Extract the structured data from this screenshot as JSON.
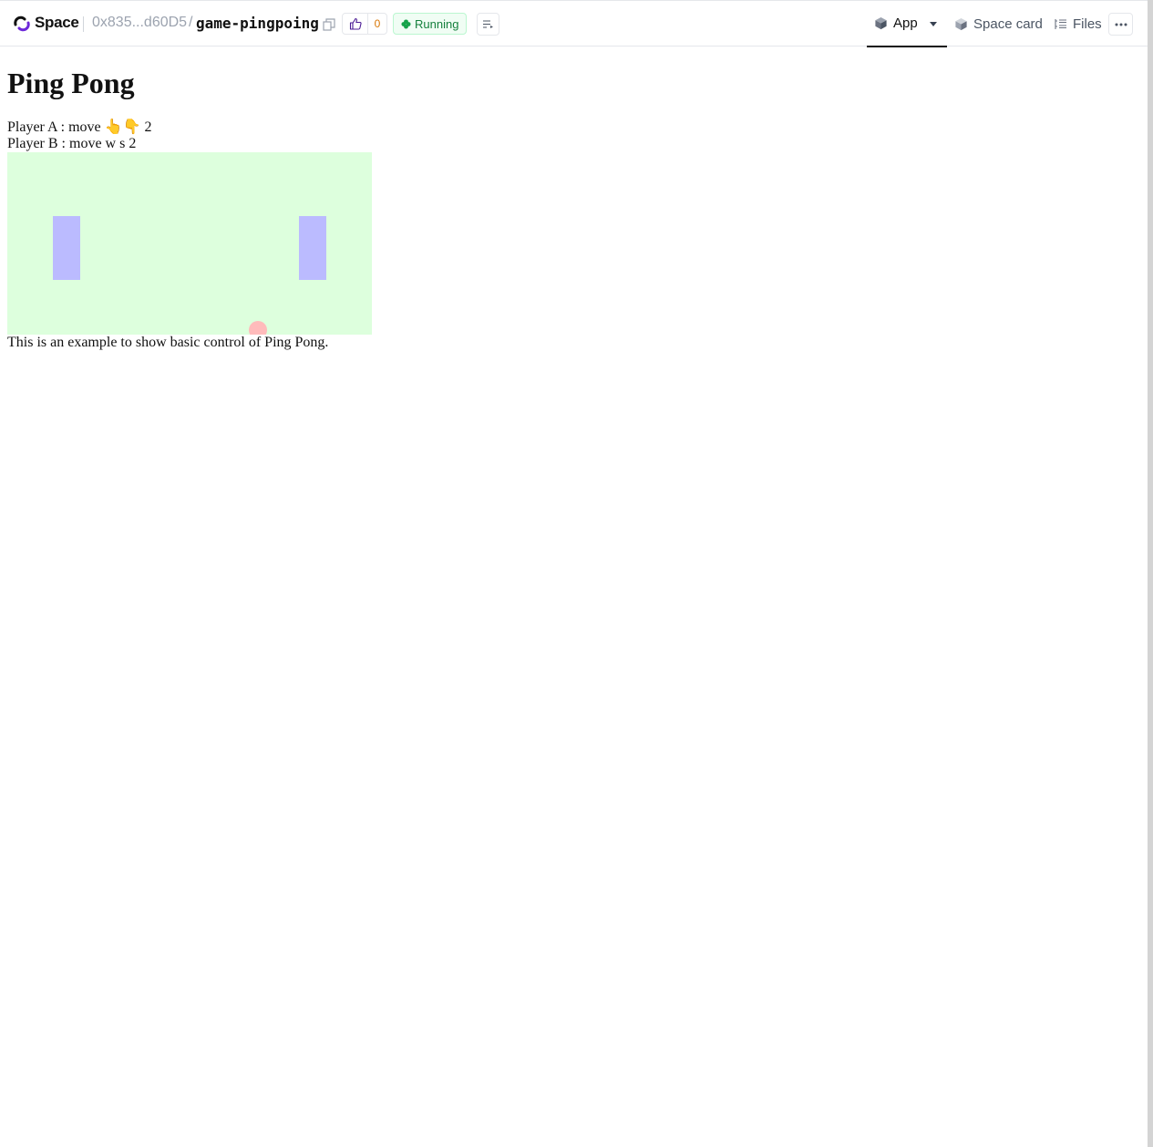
{
  "header": {
    "brand": "Space",
    "owner": "0x835...d60D5",
    "separator": "/",
    "repo_name": "game-pingpoing",
    "like_count": "0",
    "status": "Running",
    "tabs": {
      "app": "App",
      "space_card": "Space card",
      "files": "Files"
    }
  },
  "app": {
    "title": "Ping Pong",
    "player_a": "Player A : move 👆👇 2",
    "player_b": "Player B : move w s 2",
    "description": "This is an example to show basic control of Ping Pong."
  },
  "colors": {
    "accent": "#111111",
    "status_green": "#15803d",
    "like_count": "#d97706",
    "field": "#ddffdd",
    "paddle": "#bbbbff",
    "ball": "#ffbbbb"
  }
}
